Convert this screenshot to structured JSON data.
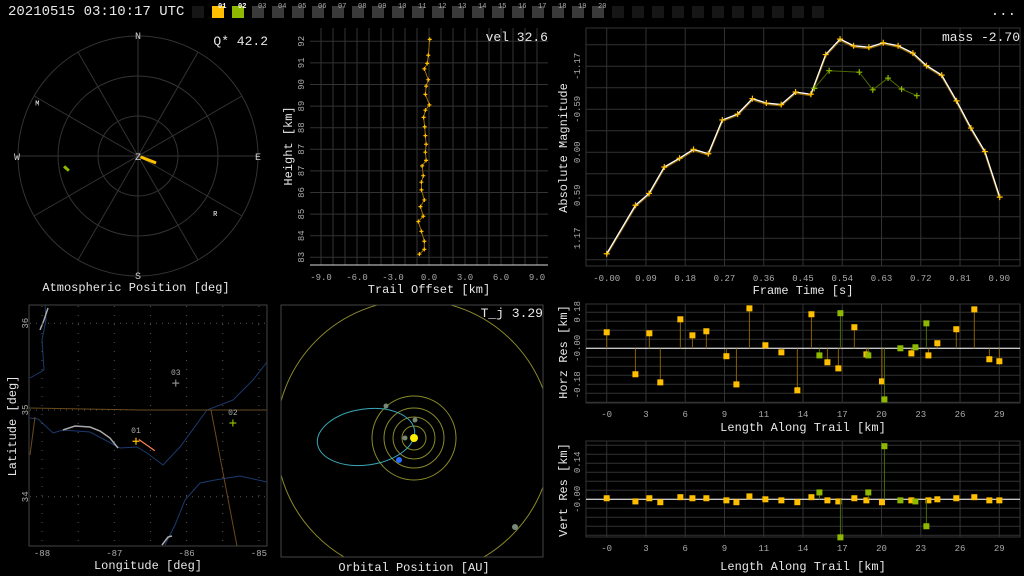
{
  "header": {
    "timestamp": "20210515 03:10:17 UTC",
    "menu": "...",
    "tabs": [
      {
        "label": "01",
        "active": true,
        "color": "#ffbf00"
      },
      {
        "label": "02",
        "active": true,
        "color": "#8fb800"
      },
      {
        "label": "03"
      },
      {
        "label": "04"
      },
      {
        "label": "05"
      },
      {
        "label": "06"
      },
      {
        "label": "07"
      },
      {
        "label": "08"
      },
      {
        "label": "09"
      },
      {
        "label": "10"
      },
      {
        "label": "11"
      },
      {
        "label": "12"
      },
      {
        "label": "13"
      },
      {
        "label": "14"
      },
      {
        "label": "15"
      },
      {
        "label": "16"
      },
      {
        "label": "17"
      },
      {
        "label": "18"
      },
      {
        "label": "19"
      },
      {
        "label": "20"
      }
    ]
  },
  "colors": {
    "station_01": "#ffbf00",
    "station_02": "#8fb800",
    "station_03": "#888888",
    "grid": "#333333",
    "fit": "#ffffff"
  },
  "polar": {
    "title": "Atmospheric Position [deg]",
    "stat": "Q* 42.2",
    "compass": {
      "N": "N",
      "E": "E",
      "S": "S",
      "W": "W",
      "Z": "Z"
    },
    "markers": [
      {
        "label": "M",
        "az": 298,
        "zen": 85.5
      },
      {
        "label": "R",
        "az": 126.5,
        "zen": 72
      }
    ],
    "trails": [
      {
        "station": "01",
        "from": {
          "az": 110,
          "zen": 2
        },
        "to": {
          "az": 111,
          "zen": 14.5
        }
      },
      {
        "station": "02",
        "from": {
          "az": 262,
          "zen": 56
        },
        "to": {
          "az": 258,
          "zen": 53
        }
      }
    ]
  },
  "map": {
    "xlabel": "Longitude [deg]",
    "ylabel": "Latitude [deg]",
    "xticks": [
      "-88",
      "-87",
      "-86",
      "-85"
    ],
    "yticks": [
      "36",
      "35",
      "34"
    ],
    "stations": [
      {
        "label": "01",
        "lon": -86.7,
        "lat": 34.64
      },
      {
        "label": "02",
        "lon": -85.36,
        "lat": 34.85
      },
      {
        "label": "03",
        "lon": -86.15,
        "lat": 35.31
      }
    ],
    "trail": {
      "from": {
        "lon": -86.66,
        "lat": 34.66
      },
      "to": {
        "lon": -86.44,
        "lat": 34.53
      }
    }
  },
  "orbit": {
    "title": "Orbital Position [AU]",
    "stat": "T_j 3.29"
  },
  "chart_data": [
    {
      "id": "trail",
      "type": "line",
      "xlabel": "Trail Offset [km]",
      "ylabel": "Height [km]",
      "stat": "vel 32.6",
      "xlim": [
        -9.9,
        10
      ],
      "ylim": [
        82.4,
        93.0
      ],
      "xticks": [
        "-9.0",
        "-6.0",
        "-3.0",
        "0.0",
        "3.0",
        "6.0",
        "9.0"
      ],
      "xtick_values": [
        -9,
        -6,
        -3,
        0,
        3,
        6,
        9
      ],
      "yticks": [
        "92",
        "91",
        "90",
        "89",
        "88",
        "87",
        "87",
        "86",
        "85",
        "84",
        "83"
      ],
      "points": [
        [
          0.06,
          92.08
        ],
        [
          -0.06,
          91.42
        ],
        [
          -0.15,
          91.08
        ],
        [
          -0.39,
          90.85
        ],
        [
          -0.06,
          90.4
        ],
        [
          -0.24,
          90.13
        ],
        [
          -0.3,
          89.79
        ],
        [
          0.03,
          89.35
        ],
        [
          -0.3,
          89.13
        ],
        [
          -0.45,
          88.83
        ],
        [
          -0.36,
          88.44
        ],
        [
          -0.3,
          88.07
        ],
        [
          -0.24,
          87.71
        ],
        [
          -0.3,
          87.38
        ],
        [
          -0.24,
          87.04
        ],
        [
          -0.57,
          86.81
        ],
        [
          -0.48,
          86.4
        ],
        [
          -0.63,
          86.13
        ],
        [
          -0.63,
          85.81
        ],
        [
          -0.39,
          85.39
        ],
        [
          -0.71,
          85.11
        ],
        [
          -0.48,
          84.71
        ],
        [
          -0.89,
          84.49
        ],
        [
          -0.63,
          84.08
        ],
        [
          -0.39,
          83.67
        ],
        [
          -0.39,
          83.33
        ],
        [
          -0.8,
          83.13
        ]
      ]
    },
    {
      "id": "magnitude",
      "type": "line",
      "xlabel": "Frame Time [s]",
      "ylabel": "Absolute Magnitude",
      "stat": "mass -2.70",
      "xticks": [
        "-0.00",
        "0.09",
        "0.18",
        "0.27",
        "0.36",
        "0.45",
        "0.54",
        "0.63",
        "0.72",
        "0.81",
        "0.90"
      ],
      "yticks": [
        "-1.17",
        "-0.59",
        "0.00",
        "0.59",
        "1.17"
      ],
      "ytick_values": [
        -1.17,
        -0.585,
        0,
        0.585,
        1.17
      ],
      "series": [
        {
          "name": "01",
          "t": [
            0,
            0.066,
            0.097,
            0.132,
            0.167,
            0.199,
            0.233,
            0.265,
            0.3,
            0.334,
            0.366,
            0.4,
            0.433,
            0.468,
            0.502,
            0.535,
            0.566,
            0.601,
            0.634,
            0.668,
            0.702,
            0.733,
            0.768,
            0.802,
            0.835,
            0.867,
            0.901
          ],
          "mag": [
            1.38,
            0.72,
            0.56,
            0.2,
            0.08,
            -0.04,
            0.02,
            -0.44,
            -0.52,
            -0.73,
            -0.67,
            -0.65,
            -0.82,
            -0.79,
            -1.33,
            -1.54,
            -1.45,
            -1.43,
            -1.49,
            -1.45,
            -1.35,
            -1.18,
            -1.05,
            -0.7,
            -0.33,
            -0.01,
            0.61
          ]
        },
        {
          "name": "02",
          "t": [
            0.476,
            0.51,
            0.579,
            0.61,
            0.645,
            0.676,
            0.711
          ],
          "mag": [
            -0.87,
            -1.11,
            -1.09,
            -0.85,
            -1.01,
            -0.86,
            -0.77
          ]
        }
      ]
    },
    {
      "id": "horz_res",
      "type": "scatter",
      "xlabel": "Length Along Trail [km]",
      "ylabel": "Horz Res [km]",
      "xticks": [
        "-0",
        "3",
        "6",
        "9",
        "11",
        "14",
        "17",
        "20",
        "23",
        "26",
        "29"
      ],
      "yticks": [
        "0.18",
        "-0.00",
        "-0.18"
      ],
      "ytick_values": [
        0.18,
        0,
        -0.18
      ],
      "series": [
        {
          "name": "01",
          "x": [
            0,
            2.12,
            3.15,
            3.96,
            5.44,
            6.33,
            7.36,
            8.84,
            9.58,
            10.54,
            11.72,
            12.9,
            14.08,
            15.12,
            16.3,
            17.11,
            18.29,
            19.18,
            20.33,
            22.5,
            23.76,
            24.42,
            25.82,
            27.15,
            28.26,
            29.0
          ],
          "y": [
            0.079,
            -0.128,
            0.074,
            -0.168,
            0.143,
            0.064,
            0.084,
            -0.039,
            -0.178,
            0.197,
            0.015,
            -0.02,
            -0.207,
            0.168,
            -0.069,
            -0.099,
            0.104,
            -0.03,
            -0.163,
            -0.025,
            -0.035,
            0.025,
            0.094,
            0.192,
            -0.054,
            -0.064
          ]
        },
        {
          "name": "02",
          "x": [
            15.71,
            17.26,
            19.32,
            20.51,
            21.69,
            22.8,
            23.61
          ],
          "y": [
            -0.035,
            0.173,
            -0.035,
            -0.252,
            0.0,
            0.005,
            0.123
          ]
        }
      ]
    },
    {
      "id": "vert_res",
      "type": "scatter",
      "xlabel": "Length Along Trail [km]",
      "ylabel": "Vert Res [km]",
      "xticks": [
        "-0",
        "3",
        "6",
        "9",
        "11",
        "14",
        "17",
        "20",
        "23",
        "26",
        "29"
      ],
      "yticks": [
        "0.14",
        "-0.00"
      ],
      "ytick_values": [
        0.14,
        0
      ],
      "series": [
        {
          "name": "01",
          "x": [
            0,
            2.12,
            3.15,
            3.96,
            5.44,
            6.33,
            7.36,
            8.84,
            9.58,
            10.54,
            11.72,
            12.9,
            14.08,
            15.12,
            16.3,
            17.11,
            18.29,
            19.18,
            20.33,
            22.5,
            23.76,
            24.42,
            25.82,
            27.15,
            28.26,
            29.0
          ],
          "y": [
            0.004,
            -0.008,
            0.004,
            -0.011,
            0.008,
            0.004,
            0.004,
            -0.004,
            -0.011,
            0.011,
            0,
            -0.004,
            -0.011,
            0.008,
            -0.004,
            -0.008,
            0.004,
            -0.004,
            -0.011,
            -0.004,
            -0.004,
            0,
            0.004,
            0.008,
            -0.004,
            -0.004
          ]
        },
        {
          "name": "02",
          "x": [
            15.71,
            17.26,
            19.32,
            20.51,
            21.69,
            22.8,
            23.61
          ],
          "y": [
            0.026,
            -0.144,
            0.026,
            0.201,
            -0.004,
            -0.008,
            -0.102
          ]
        }
      ]
    }
  ]
}
